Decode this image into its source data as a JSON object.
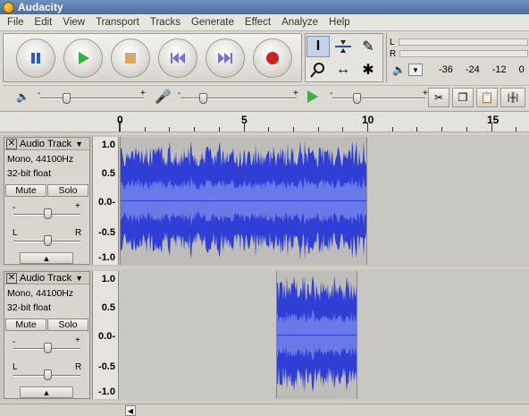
{
  "window": {
    "title": "Audacity",
    "icon": "audacity-app-icon"
  },
  "menu": [
    "File",
    "Edit",
    "View",
    "Transport",
    "Tracks",
    "Generate",
    "Effect",
    "Analyze",
    "Help"
  ],
  "transport": {
    "buttons": [
      {
        "name": "pause-button",
        "icon": "pause-icon",
        "color": "#2a5bd7"
      },
      {
        "name": "play-button",
        "icon": "play-icon",
        "color": "#3cb043"
      },
      {
        "name": "stop-button",
        "icon": "stop-icon",
        "color": "#d9a66b"
      },
      {
        "name": "skip-start-button",
        "icon": "skip-to-start-icon",
        "color": "#7b6be0"
      },
      {
        "name": "skip-end-button",
        "icon": "skip-to-end-icon",
        "color": "#7b6be0"
      },
      {
        "name": "record-button",
        "icon": "record-icon",
        "color": "#cc2222"
      }
    ]
  },
  "tools": {
    "items": [
      {
        "name": "selection-tool",
        "glyph": "I",
        "active": true
      },
      {
        "name": "envelope-tool",
        "glyph": "envelope",
        "active": false
      },
      {
        "name": "draw-tool",
        "glyph": "✎",
        "active": false
      },
      {
        "name": "zoom-tool",
        "glyph": "🔍",
        "active": false
      },
      {
        "name": "timeshift-tool",
        "glyph": "↔",
        "active": false
      },
      {
        "name": "multi-tool",
        "glyph": "✱",
        "active": false
      }
    ]
  },
  "meter": {
    "left_label": "L",
    "right_label": "R",
    "scale": [
      "-36",
      "-24",
      "-12",
      "0"
    ]
  },
  "ruler": {
    "labels": [
      "0",
      "5",
      "10",
      "15"
    ]
  },
  "tracks": [
    {
      "name": "Audio Track",
      "format": "Mono, 44100Hz",
      "bit_depth": "32-bit float",
      "mute_label": "Mute",
      "solo_label": "Solo",
      "gain_minus": "-",
      "gain_plus": "+",
      "pan_left": "L",
      "pan_right": "R",
      "scale_labels": [
        "1.0",
        "0.5",
        "0.0-",
        "-0.5",
        "-1.0"
      ],
      "clip_start_sec": 0,
      "clip_end_sec": 10
    },
    {
      "name": "Audio Track",
      "format": "Mono, 44100Hz",
      "bit_depth": "32-bit float",
      "mute_label": "Mute",
      "solo_label": "Solo",
      "gain_minus": "-",
      "gain_plus": "+",
      "pan_left": "L",
      "pan_right": "R",
      "scale_labels": [
        "1.0",
        "0.5",
        "0.0-",
        "-0.5",
        "-1.0"
      ],
      "clip_start_sec": 6.3,
      "clip_end_sec": 9.6
    }
  ],
  "colors": {
    "waveform_outer": "#2f3fd6",
    "waveform_inner": "#6a79e8"
  }
}
